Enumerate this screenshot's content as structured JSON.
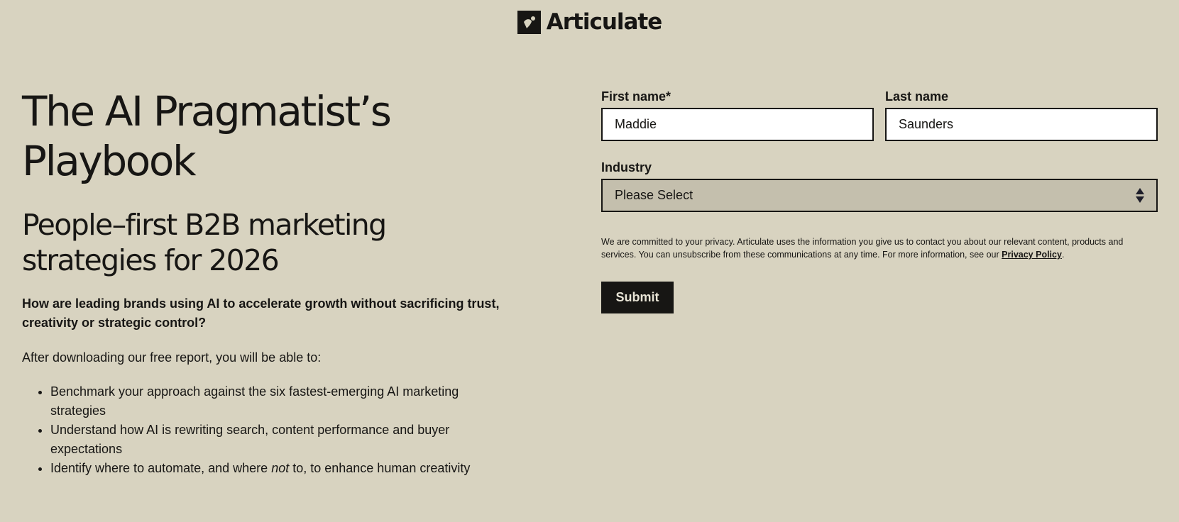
{
  "brand": {
    "name": "Articulate"
  },
  "hero": {
    "title_line1": "The AI Pragmatist’s",
    "title_line2": "Playbook",
    "subtitle_line1": "People–first B2B marketing",
    "subtitle_line2": "strategies for 2026",
    "question": "How are leading brands using AI to accelerate growth without sacrificing trust, creativity or strategic control?",
    "intro": "After downloading our free report, you will be able to:",
    "benefits": [
      {
        "text": "Benchmark your approach against the six fastest-emerging AI marketing strategies"
      },
      {
        "text": "Understand how AI is rewriting search, content performance and buyer expectations"
      },
      {
        "before": "Identify where to automate, and where ",
        "emphasis": "not",
        "after": " to, to enhance human creativity"
      }
    ]
  },
  "form": {
    "first_name": {
      "label": "First name*",
      "value": "Maddie"
    },
    "last_name": {
      "label": "Last name",
      "value": "Saunders"
    },
    "industry": {
      "label": "Industry",
      "selected": "Please Select"
    },
    "privacy_text": "We are committed to your privacy. Articulate uses the information you give us to contact you about our relevant content, products and services. You can unsubscribe from these communications at any time. For more information, see our ",
    "privacy_link": "Privacy Policy",
    "privacy_end": ".",
    "submit_label": "Submit"
  },
  "colors": {
    "background": "#d8d3c0",
    "text": "#171614",
    "select_bg": "#c4bfad",
    "button_bg": "#171614",
    "button_text": "#e8e4d6"
  }
}
